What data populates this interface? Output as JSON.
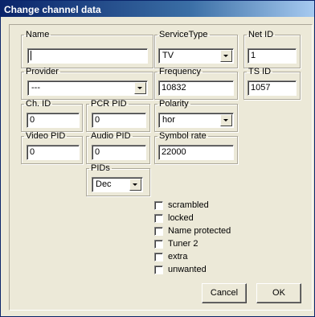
{
  "window": {
    "title": "Change channel data"
  },
  "fields": {
    "name": {
      "label": "Name",
      "value": ""
    },
    "service_type": {
      "label": "ServiceType",
      "value": "TV"
    },
    "net_id": {
      "label": "Net ID",
      "value": "1"
    },
    "provider": {
      "label": "Provider",
      "value": "---"
    },
    "frequency": {
      "label": "Frequency",
      "value": "10832"
    },
    "ts_id": {
      "label": "TS ID",
      "value": "1057"
    },
    "ch_id": {
      "label": "Ch. ID",
      "value": "0"
    },
    "pcr_pid": {
      "label": "PCR PID",
      "value": "0"
    },
    "polarity": {
      "label": "Polarity",
      "value": "hor"
    },
    "video_pid": {
      "label": "Video PID",
      "value": "0"
    },
    "audio_pid": {
      "label": "Audio PID",
      "value": "0"
    },
    "symbol_rate": {
      "label": "Symbol rate",
      "value": "22000"
    },
    "pids": {
      "label": "PIDs",
      "value": "Dec"
    }
  },
  "checkboxes": [
    {
      "label": "scrambled",
      "checked": false
    },
    {
      "label": "locked",
      "checked": false
    },
    {
      "label": "Name protected",
      "checked": false
    },
    {
      "label": "Tuner 2",
      "checked": false
    },
    {
      "label": "extra",
      "checked": false
    },
    {
      "label": "unwanted",
      "checked": false
    }
  ],
  "buttons": {
    "cancel": "Cancel",
    "ok": "OK"
  }
}
